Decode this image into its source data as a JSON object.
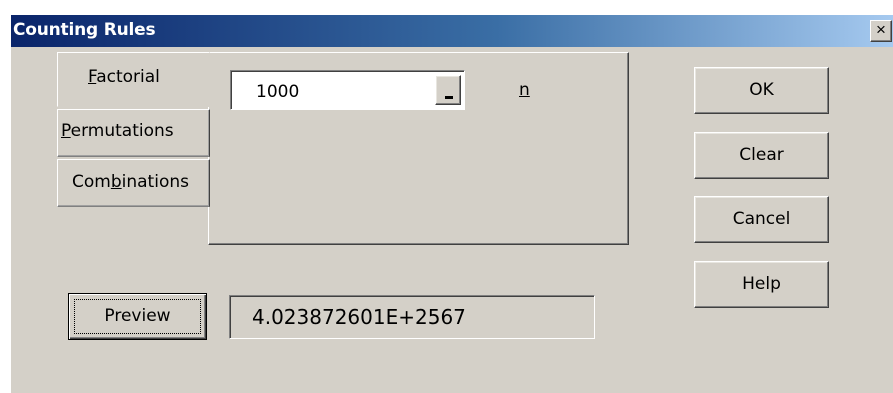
{
  "window": {
    "title": "Counting Rules",
    "close_glyph": "×"
  },
  "tabs": {
    "factorial": {
      "pre": "",
      "accel": "F",
      "post": "actorial"
    },
    "permutations": {
      "pre": "",
      "accel": "P",
      "post": "ermutations"
    },
    "combinations": {
      "pre": "Com",
      "accel": "b",
      "post": "inations"
    }
  },
  "factorial_panel": {
    "n_value": "1000",
    "n_label": "n"
  },
  "buttons": {
    "ok": "OK",
    "clear": "Clear",
    "cancel": "Cancel",
    "help": "Help",
    "preview": "Preview"
  },
  "result": {
    "value": "4.023872601E+2567"
  },
  "icons": {
    "close": "close-icon",
    "combo_button": "minus-icon"
  }
}
